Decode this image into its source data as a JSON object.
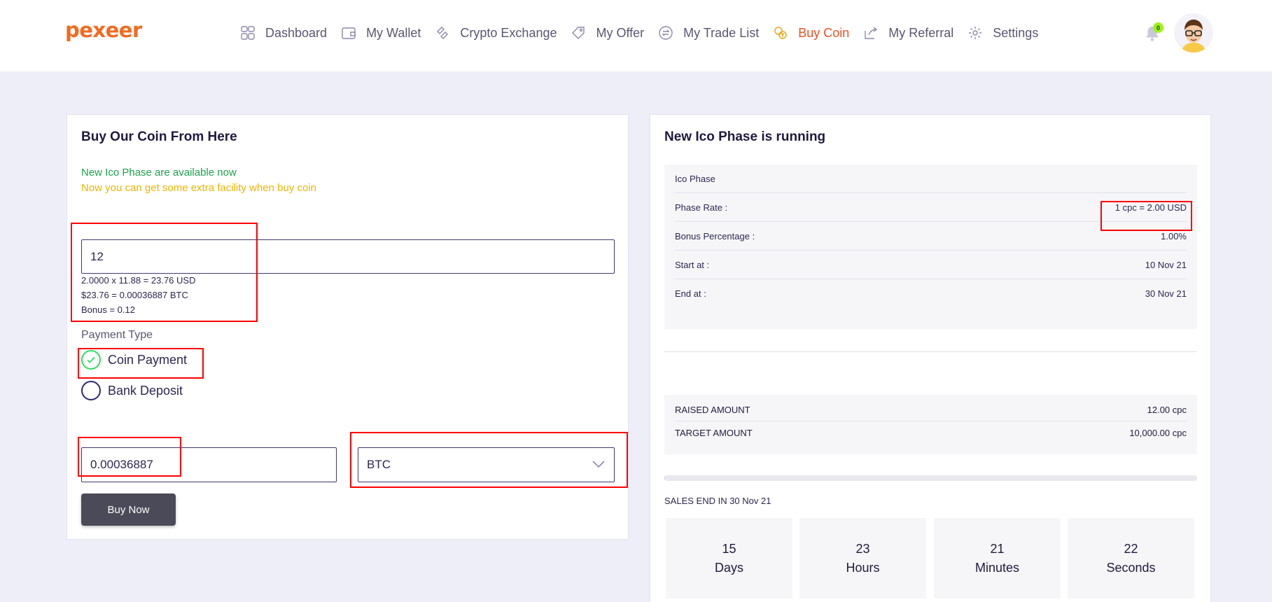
{
  "brand": {
    "logo_text": "pexeer",
    "accent": "#f26a21"
  },
  "nav": {
    "items": [
      {
        "label": "Dashboard",
        "icon": "dashboard-icon"
      },
      {
        "label": "My Wallet",
        "icon": "wallet-icon"
      },
      {
        "label": "Crypto Exchange",
        "icon": "exchange-icon"
      },
      {
        "label": "My Offer",
        "icon": "tag-icon"
      },
      {
        "label": "My Trade List",
        "icon": "trade-icon"
      },
      {
        "label": "Buy Coin",
        "icon": "coin-icon",
        "active": true
      },
      {
        "label": "My Referral",
        "icon": "share-icon"
      },
      {
        "label": "Settings",
        "icon": "gear-icon"
      }
    ],
    "active_color": "#f04e23"
  },
  "header": {
    "notification_count": "0"
  },
  "buy_card": {
    "title": "Buy Our Coin From Here",
    "msg_available": "New Ico Phase are available now",
    "msg_facility": "Now you can get some extra facility when buy coin",
    "quantity_value": "12",
    "calc_line1": "2.0000 x 11.88 = 23.76 USD",
    "calc_line2": "$23.76 = 0.00036887 BTC",
    "calc_line3": "Bonus = 0.12",
    "payment_type_label": "Payment Type",
    "payment_options": [
      {
        "label": "Coin Payment",
        "checked": true
      },
      {
        "label": "Bank Deposit",
        "checked": false
      }
    ],
    "amount_value": "0.00036887",
    "currency_selected": "BTC",
    "buy_button": "Buy Now"
  },
  "ico_card": {
    "title": "New Ico Phase is running",
    "rows": [
      {
        "label": "Ico Phase",
        "value": ""
      },
      {
        "label": "Phase Rate :",
        "value": "1 cpc = 2.00 USD"
      },
      {
        "label": "Bonus Percentage :",
        "value": "1.00%"
      },
      {
        "label": "Start at :",
        "value": "10 Nov 21"
      },
      {
        "label": "End at :",
        "value": "30 Nov 21"
      }
    ],
    "raised_label": "RAISED AMOUNT",
    "raised_value": "12.00 cpc",
    "target_label": "TARGET AMOUNT",
    "target_value": "10,000.00 cpc",
    "progress_fraction": 0.0012,
    "sales_end": "SALES END IN 30 Nov 21",
    "countdown": [
      {
        "value": "15",
        "unit": "Days"
      },
      {
        "value": "23",
        "unit": "Hours"
      },
      {
        "value": "21",
        "unit": "Minutes"
      },
      {
        "value": "22",
        "unit": "Seconds"
      }
    ]
  }
}
